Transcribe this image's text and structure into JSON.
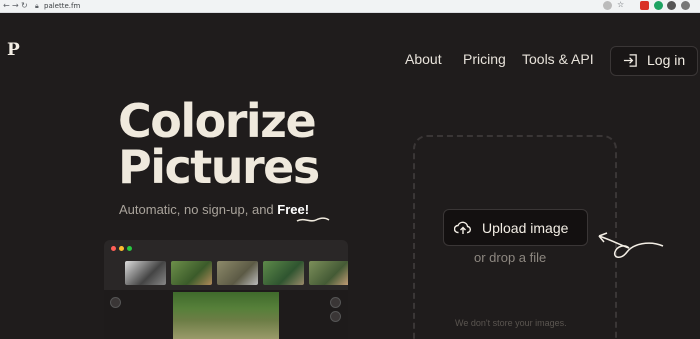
{
  "browser": {
    "back_icon": "arrow-left-icon",
    "forward_icon": "arrow-right-icon",
    "reload_icon": "reload-icon",
    "url": "palette.fm"
  },
  "header": {
    "logo": "P",
    "nav": [
      {
        "label": "About"
      },
      {
        "label": "Pricing"
      },
      {
        "label": "Tools & API"
      }
    ],
    "login_label": "Log in"
  },
  "hero": {
    "title_line1": "Colorize",
    "title_line2": "Pictures",
    "subtitle_prefix": "Automatic, no sign-up, and ",
    "subtitle_free": "Free!"
  },
  "upload": {
    "button_label": "Upload image",
    "drop_hint": "or drop a file",
    "privacy_note": "We don't store your images."
  },
  "colors": {
    "background": "#1f1c1c",
    "text_primary": "#efe9dd",
    "text_muted": "#a9a39b"
  }
}
